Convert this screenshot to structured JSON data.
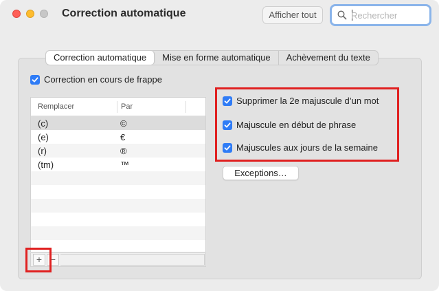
{
  "window": {
    "title": "Correction automatique"
  },
  "toolbar": {
    "show_all_label": "Afficher tout",
    "search_placeholder": "Rechercher"
  },
  "tabs": [
    {
      "label": "Correction automatique",
      "active": true
    },
    {
      "label": "Mise en forme automatique",
      "active": false
    },
    {
      "label": "Achèvement du texte",
      "active": false
    }
  ],
  "main": {
    "typing_correction_label": "Correction en cours de frappe",
    "typing_correction_checked": true,
    "table": {
      "columns": [
        "Remplacer",
        "Par"
      ],
      "rows": [
        {
          "replace": "(c)",
          "with": "©"
        },
        {
          "replace": "(e)",
          "with": "€"
        },
        {
          "replace": "(r)",
          "with": "®"
        },
        {
          "replace": "(tm)",
          "with": "™"
        }
      ],
      "add_label": "+",
      "remove_label": "−"
    },
    "options": [
      {
        "label": "Supprimer la 2e majuscule d’un mot",
        "checked": true
      },
      {
        "label": "Majuscule en début de phrase",
        "checked": true
      },
      {
        "label": "Majuscules aux jours de la semaine",
        "checked": true
      }
    ],
    "exceptions_label": "Exceptions…"
  },
  "colors": {
    "accent": "#2f7cf6",
    "highlight": "#e02020"
  }
}
